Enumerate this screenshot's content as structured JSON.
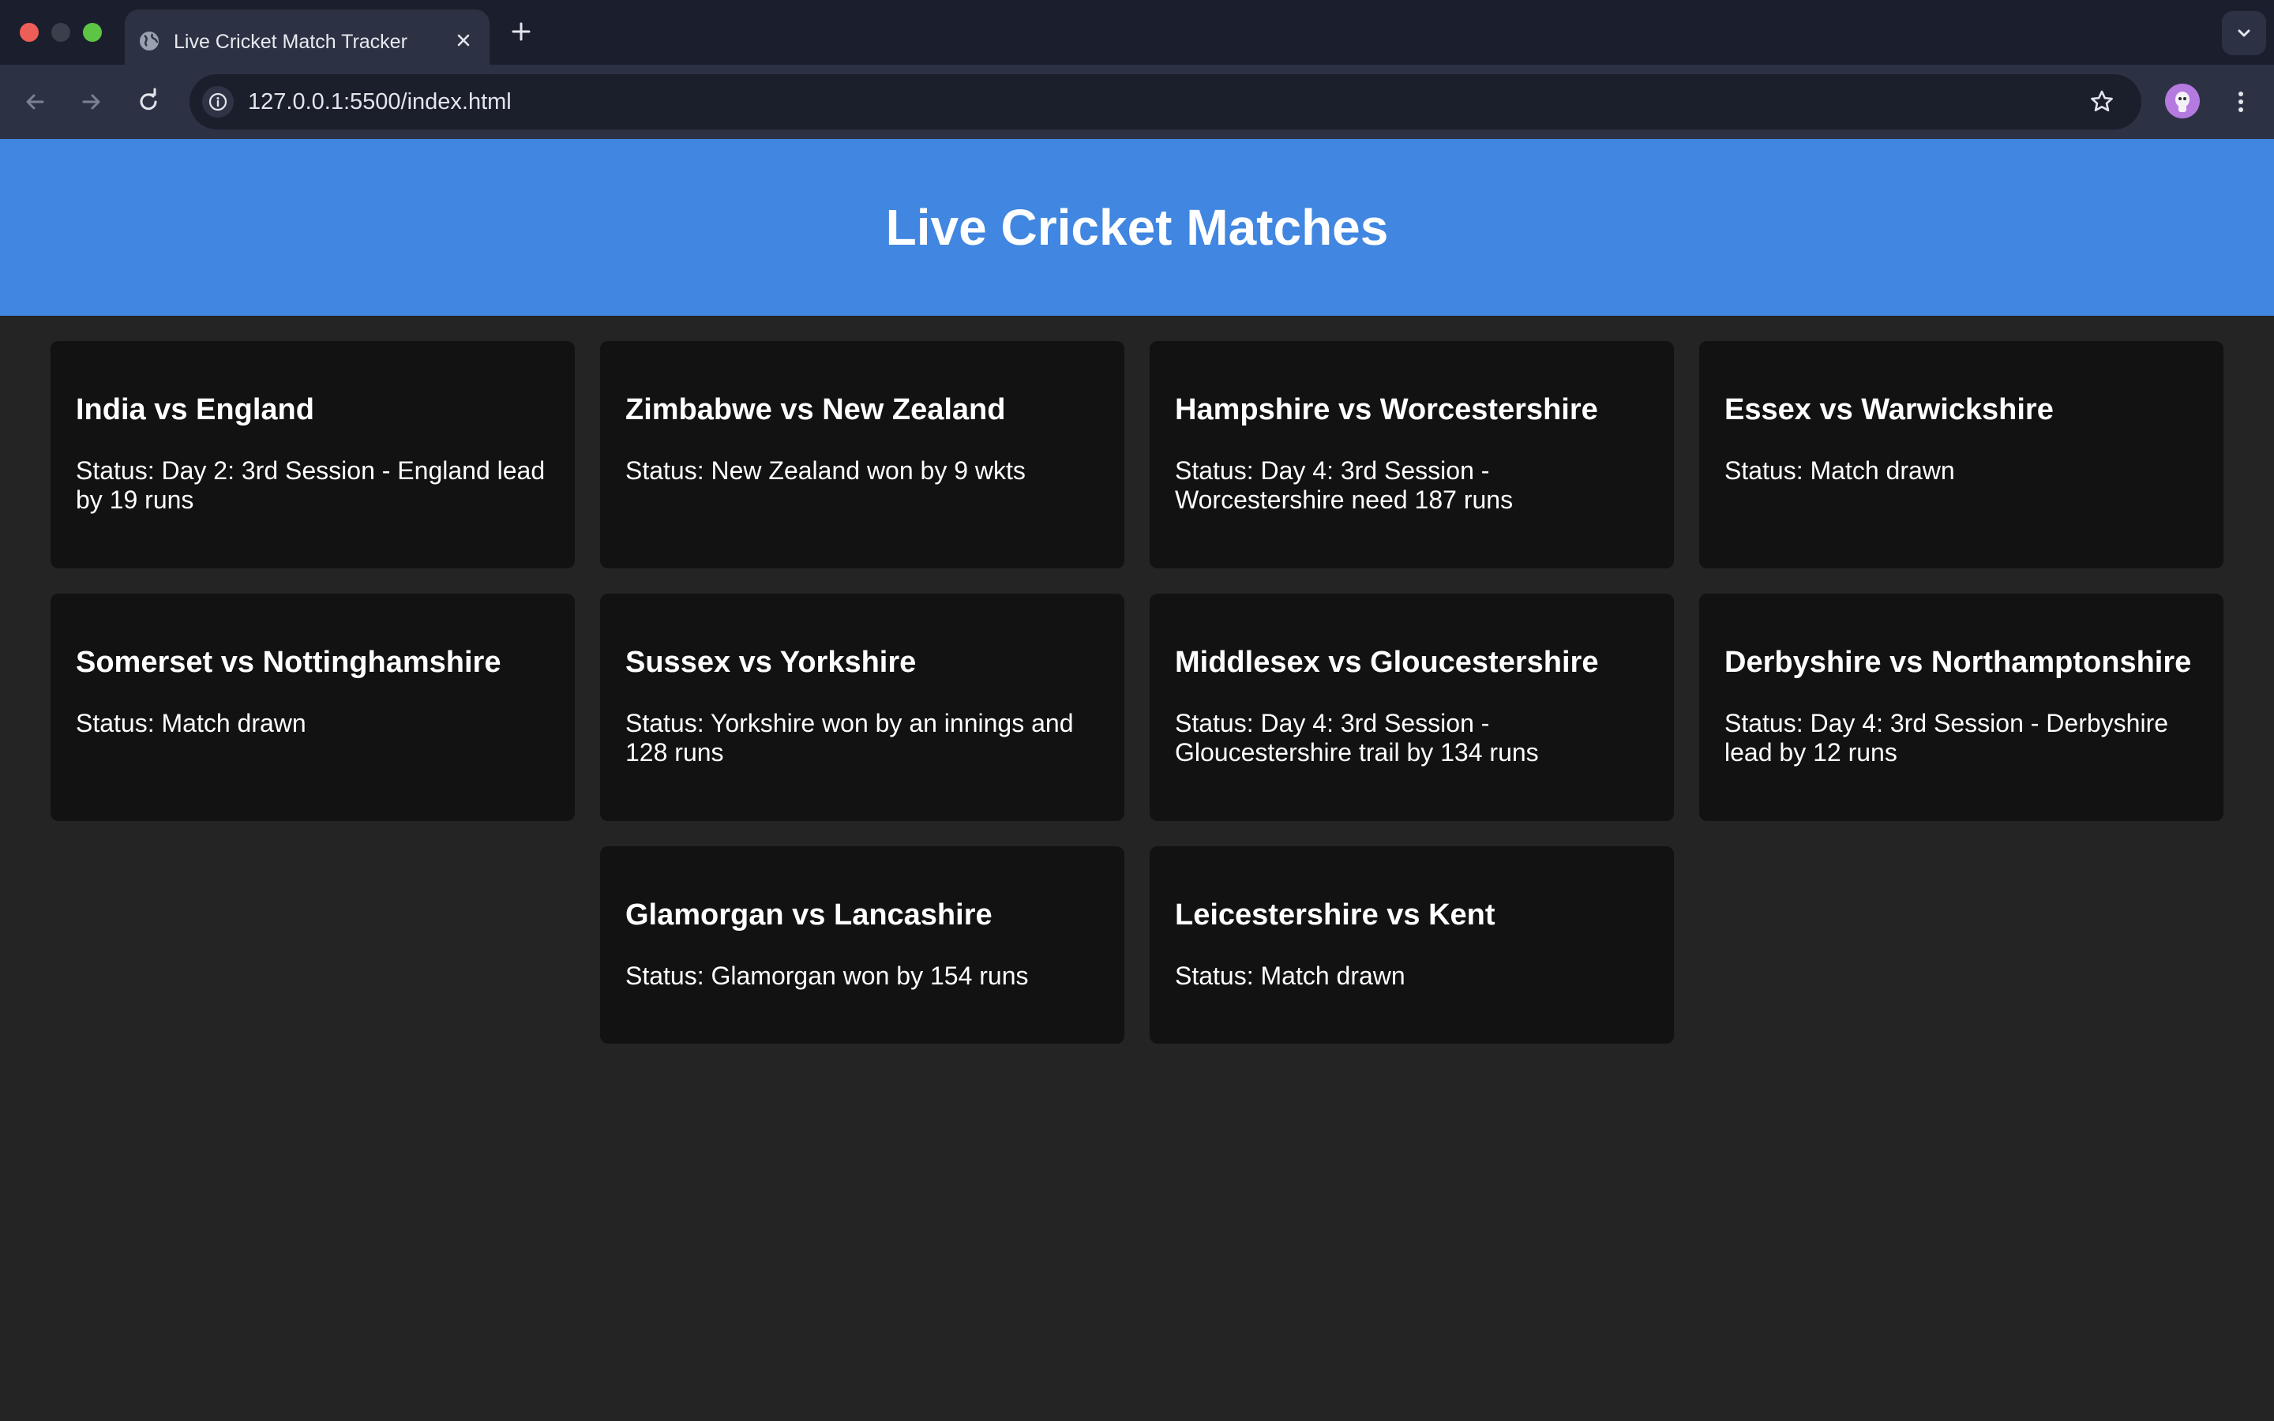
{
  "browser": {
    "tab_title": "Live Cricket Match Tracker",
    "url": "127.0.0.1:5500/index.html",
    "icons": {
      "tab": "globe-icon",
      "close": "close-icon",
      "new_tab": "plus-icon",
      "tab_search": "chevron-down-icon",
      "back": "arrow-left-icon",
      "forward": "arrow-right-icon",
      "reload": "reload-icon",
      "site_info": "info-icon",
      "bookmark": "star-icon",
      "profile": "avatar-icon",
      "menu": "kebab-menu-icon"
    },
    "colors": {
      "chrome_bg": "#1b1f2d",
      "active_tab_bg": "#2c3244",
      "omnibox_bg": "#1b1f2b"
    }
  },
  "page": {
    "title": "Live Cricket Matches",
    "colors": {
      "header_bg": "#4186e0",
      "page_bg": "#242424",
      "card_bg": "#121212",
      "text": "#ffffff"
    },
    "matches": [
      {
        "title": "India vs England",
        "status": "Status: Day 2: 3rd Session - England lead by 19 runs"
      },
      {
        "title": "Zimbabwe vs New Zealand",
        "status": "Status: New Zealand won by 9 wkts"
      },
      {
        "title": "Hampshire vs Worcestershire",
        "status": "Status: Day 4: 3rd Session - Worcestershire need 187 runs"
      },
      {
        "title": "Essex vs Warwickshire",
        "status": "Status: Match drawn"
      },
      {
        "title": "Somerset vs Nottinghamshire",
        "status": "Status: Match drawn"
      },
      {
        "title": "Sussex vs Yorkshire",
        "status": "Status: Yorkshire won by an innings and 128 runs"
      },
      {
        "title": "Middlesex vs Gloucestershire",
        "status": "Status: Day 4: 3rd Session - Gloucestershire trail by 134 runs"
      },
      {
        "title": "Derbyshire vs Northamptonshire",
        "status": "Status: Day 4: 3rd Session - Derbyshire lead by 12 runs"
      },
      {
        "title": "Glamorgan vs Lancashire",
        "status": "Status: Glamorgan won by 154 runs"
      },
      {
        "title": "Leicestershire vs Kent",
        "status": "Status: Match drawn"
      }
    ]
  }
}
